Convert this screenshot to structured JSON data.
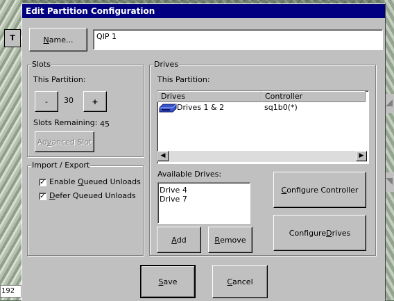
{
  "background": {
    "tab_label": "T",
    "bottom_number": "192"
  },
  "dialog": {
    "title": "Edit Partition Configuration"
  },
  "name_row": {
    "button_prefix": "",
    "button_key": "N",
    "button_rest": "ame...",
    "value": "QIP 1"
  },
  "slots": {
    "group_label": "Slots",
    "this_partition_label": "This Partition:",
    "decrement_label": "-",
    "count": "30",
    "increment_label": "+",
    "remaining_label": "Slots Remaining:",
    "remaining_value": "45",
    "advanced_prefix": "Ad",
    "advanced_key": "v",
    "advanced_rest": "anced Slot"
  },
  "import_export": {
    "group_label": "Import / Export",
    "enable_prefix": "Enable ",
    "enable_key": "Q",
    "enable_rest": "ueued Unloads",
    "enable_checked": true,
    "defer_prefix": "",
    "defer_key": "D",
    "defer_rest": "efer Queued Unloads",
    "defer_checked": true
  },
  "drives": {
    "group_label": "Drives",
    "this_partition_label": "This Partition:",
    "columns": [
      "Drives",
      "Controller"
    ],
    "rows": [
      {
        "drive": "Drives 1 & 2",
        "controller": "sq1b0(*)",
        "icon": "tape-drive-icon"
      }
    ],
    "available_label": "Available Drives:",
    "available": [
      "Drive 4",
      "Drive 7"
    ],
    "add_prefix": "",
    "add_key": "A",
    "add_rest": "dd",
    "remove_prefix": "",
    "remove_key": "R",
    "remove_rest": "emove",
    "configure_controller_prefix": "",
    "configure_controller_key": "C",
    "configure_controller_rest": "onfigure Controller",
    "configure_drives_prefix": "Configure ",
    "configure_drives_key": "D",
    "configure_drives_rest": "rives"
  },
  "footer": {
    "save_prefix": "",
    "save_key": "S",
    "save_rest": "ave",
    "cancel_prefix": "",
    "cancel_key": "C",
    "cancel_rest": "ancel"
  },
  "colors": {
    "titlebar": "#000080",
    "face": "#c0c0c0",
    "icon_blue": "#3355cc"
  }
}
